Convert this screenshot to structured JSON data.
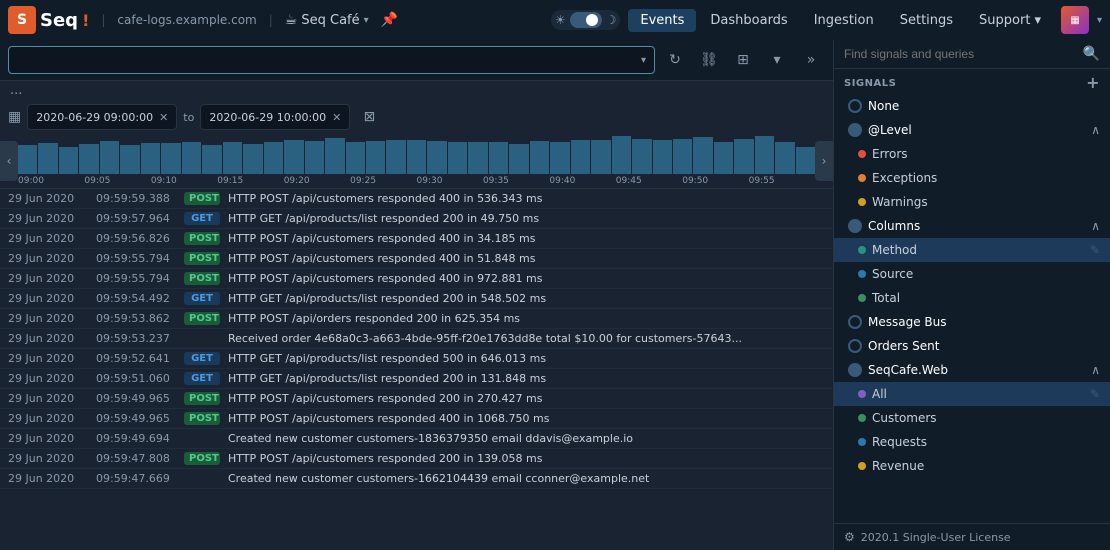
{
  "app": {
    "logo_text": "Seq",
    "site": "cafe-logs.example.com",
    "workspace_name": "Seq Café",
    "workspace_emoji": "☕",
    "pin_icon": "📌"
  },
  "nav": {
    "items": [
      {
        "label": "Events",
        "active": true
      },
      {
        "label": "Dashboards",
        "active": false
      },
      {
        "label": "Ingestion",
        "active": false
      },
      {
        "label": "Settings",
        "active": false
      },
      {
        "label": "Support",
        "active": false,
        "has_arrow": true
      }
    ]
  },
  "query_bar": {
    "placeholder": "",
    "dropdown_label": "▾",
    "refresh_icon": "↻",
    "link_icon": "🔗",
    "grid_icon": "⊞",
    "chevron_icon": "▾",
    "more_icon": "»"
  },
  "date_range": {
    "calendar_icon": "📅",
    "from": "2020-06-29 09:00:00",
    "to": "2020-06-29 10:00:00",
    "tail_icon": "⊠"
  },
  "histogram": {
    "bars": [
      80,
      85,
      75,
      82,
      90,
      78,
      85,
      85,
      88,
      78,
      88,
      82,
      87,
      92,
      91,
      99,
      88,
      91,
      94,
      92,
      91,
      87,
      88,
      88,
      82,
      91,
      87,
      92,
      94,
      104,
      96,
      93,
      95,
      100,
      88,
      96,
      103,
      88,
      75
    ],
    "axis_labels": [
      "09:00",
      "09:05",
      "09:10",
      "09:15",
      "09:20",
      "09:25",
      "09:30",
      "09:35",
      "09:40",
      "09:45",
      "09:50",
      "09:55"
    ]
  },
  "logs": [
    {
      "date": "29 Jun 2020",
      "time": "09:59:59.388",
      "method": "POST",
      "method_type": "post",
      "message": "HTTP POST /api/customers responded 400 in 536.343 ms"
    },
    {
      "date": "29 Jun 2020",
      "time": "09:59:57.964",
      "method": "GET",
      "method_type": "get",
      "message": "HTTP GET /api/products/list responded 200 in 49.750 ms"
    },
    {
      "date": "29 Jun 2020",
      "time": "09:59:56.826",
      "method": "POST",
      "method_type": "post",
      "message": "HTTP POST /api/customers responded 400 in 34.185 ms"
    },
    {
      "date": "29 Jun 2020",
      "time": "09:59:55.794",
      "method": "POST",
      "method_type": "post",
      "message": "HTTP POST /api/customers responded 400 in 51.848 ms"
    },
    {
      "date": "29 Jun 2020",
      "time": "09:59:55.794",
      "method": "POST",
      "method_type": "post",
      "message": "HTTP POST /api/customers responded 400 in 972.881 ms"
    },
    {
      "date": "29 Jun 2020",
      "time": "09:59:54.492",
      "method": "GET",
      "method_type": "get",
      "message": "HTTP GET /api/products/list responded 200 in 548.502 ms"
    },
    {
      "date": "29 Jun 2020",
      "time": "09:59:53.862",
      "method": "POST",
      "method_type": "post",
      "message": "HTTP POST /api/orders responded 200 in 625.354 ms"
    },
    {
      "date": "29 Jun 2020",
      "time": "09:59:53.237",
      "method": "",
      "method_type": "none",
      "message": "Received order 4e68a0c3-a663-4bde-95ff-f20e1763dd8e total $10.00 for customers-57643..."
    },
    {
      "date": "29 Jun 2020",
      "time": "09:59:52.641",
      "method": "GET",
      "method_type": "get",
      "message": "HTTP GET /api/products/list responded 500 in 646.013 ms"
    },
    {
      "date": "29 Jun 2020",
      "time": "09:59:51.060",
      "method": "GET",
      "method_type": "get",
      "message": "HTTP GET /api/products/list responded 200 in 131.848 ms"
    },
    {
      "date": "29 Jun 2020",
      "time": "09:59:49.965",
      "method": "POST",
      "method_type": "post",
      "message": "HTTP POST /api/customers responded 200 in 270.427 ms"
    },
    {
      "date": "29 Jun 2020",
      "time": "09:59:49.965",
      "method": "POST",
      "method_type": "post",
      "message": "HTTP POST /api/customers responded 400 in 1068.750 ms"
    },
    {
      "date": "29 Jun 2020",
      "time": "09:59:49.694",
      "method": "",
      "method_type": "none",
      "message": "Created new customer customers-1836379350 email ddavis@example.io"
    },
    {
      "date": "29 Jun 2020",
      "time": "09:59:47.808",
      "method": "POST",
      "method_type": "post",
      "message": "HTTP POST /api/customers responded 200 in 139.058 ms"
    },
    {
      "date": "29 Jun 2020",
      "time": "09:59:47.669",
      "method": "",
      "method_type": "none",
      "message": "Created new customer customers-1662104439 email cconner@example.net"
    }
  ],
  "signals": {
    "search_placeholder": "Find signals and queries",
    "section_label": "SIGNALS",
    "none_label": "None",
    "level_label": "@Level",
    "level_items": [
      {
        "label": "Errors",
        "dot": "red"
      },
      {
        "label": "Exceptions",
        "dot": "orange"
      },
      {
        "label": "Warnings",
        "dot": "yellow"
      }
    ],
    "columns_label": "Columns",
    "columns_items": [
      {
        "label": "Method",
        "active": true
      },
      {
        "label": "Source"
      },
      {
        "label": "Total"
      }
    ],
    "message_bus_label": "Message Bus",
    "orders_sent_label": "Orders Sent",
    "seqcafe_web_label": "SeqCafe.Web",
    "seqcafe_items": [
      {
        "label": "All",
        "active": true
      },
      {
        "label": "Customers"
      },
      {
        "label": "Requests"
      },
      {
        "label": "Revenue"
      }
    ],
    "footer_license": "2020.1  Single-User License"
  }
}
